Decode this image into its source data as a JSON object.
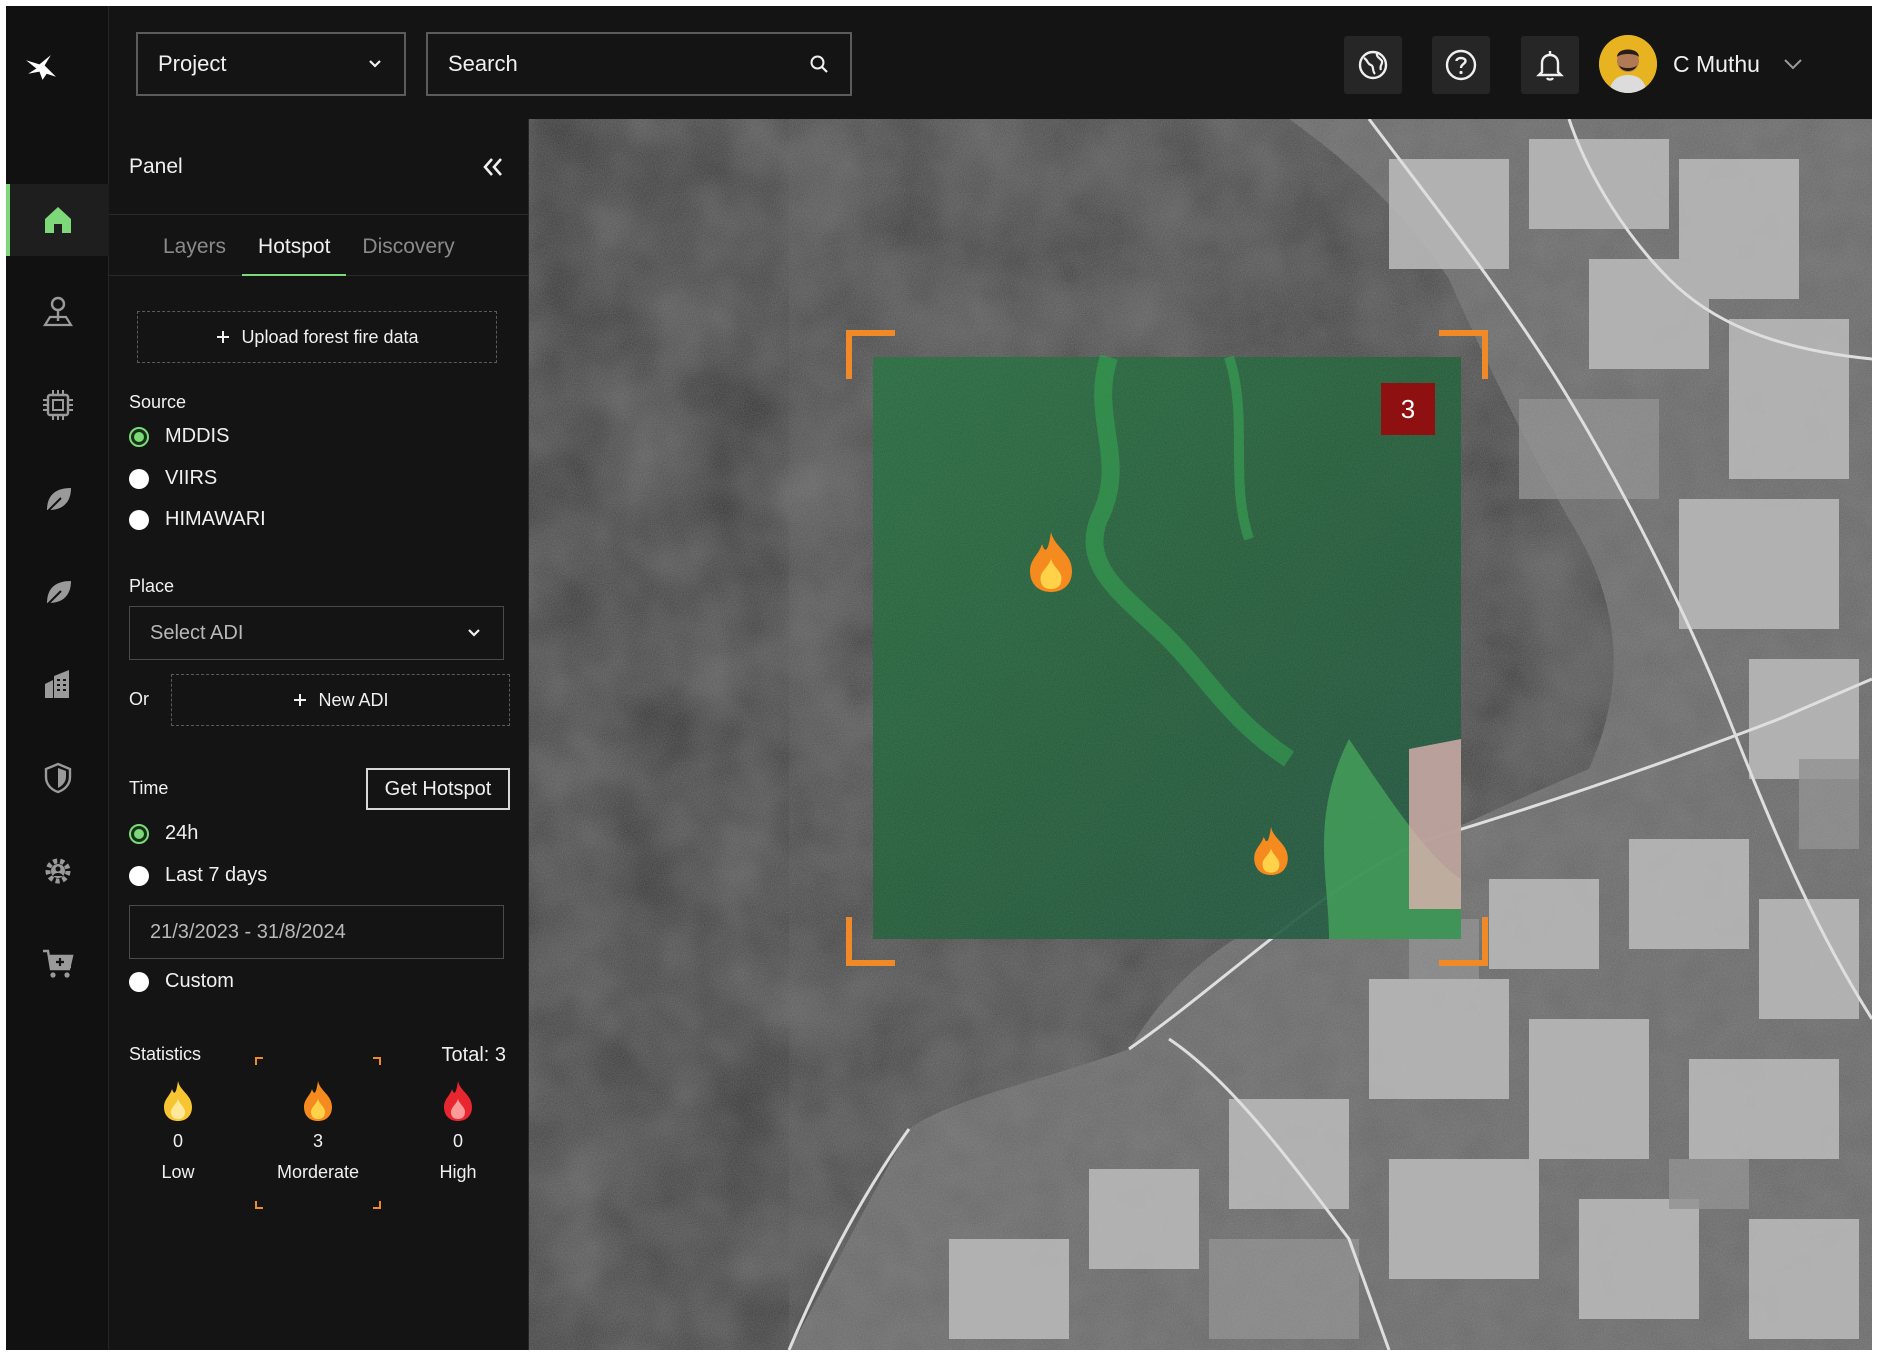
{
  "topbar": {
    "project_label": "Project",
    "search_placeholder": "Search",
    "user_name": "C Muthu"
  },
  "icons": {
    "logo": "bird-logo-icon",
    "nav": [
      "home-icon",
      "location-pin-icon",
      "chip-icon",
      "leaf-icon",
      "leaf-alt-icon",
      "buildings-icon",
      "shield-icon",
      "gear-icon",
      "cart-add-icon"
    ],
    "topbar": [
      "globe-icon",
      "help-icon",
      "bell-icon"
    ]
  },
  "panel": {
    "title": "Panel",
    "tabs": [
      {
        "label": "Layers",
        "active": false
      },
      {
        "label": "Hotspot",
        "active": true
      },
      {
        "label": "Discovery",
        "active": false
      }
    ],
    "upload_label": "Upload forest fire data",
    "source": {
      "label": "Source",
      "options": [
        {
          "label": "MDDIS",
          "checked": true
        },
        {
          "label": "VIIRS",
          "checked": false
        },
        {
          "label": "HIMAWARI",
          "checked": false
        }
      ]
    },
    "place": {
      "label": "Place",
      "select_value": "Select ADI",
      "or_label": "Or",
      "new_adi_label": "New ADI"
    },
    "time": {
      "label": "Time",
      "get_hotspot_label": "Get Hotspot",
      "options": [
        {
          "label": "24h",
          "checked": true
        },
        {
          "label": "Last 7 days",
          "checked": false
        },
        {
          "label": "Custom",
          "checked": false
        }
      ],
      "date_range": "21/3/2023 - 31/8/2024"
    },
    "statistics": {
      "label": "Statistics",
      "total": "Total: 3",
      "items": [
        {
          "count": "0",
          "label": "Low",
          "color": "#f7c531"
        },
        {
          "count": "3",
          "label": "Morderate",
          "color": "#f58a1f"
        },
        {
          "count": "0",
          "label": "High",
          "color": "#e8262f"
        }
      ]
    }
  },
  "map": {
    "aoi_count": "3",
    "accent_color": "#f08a28"
  },
  "colors": {
    "accent_green": "#7dd87a",
    "background": "#141414"
  }
}
